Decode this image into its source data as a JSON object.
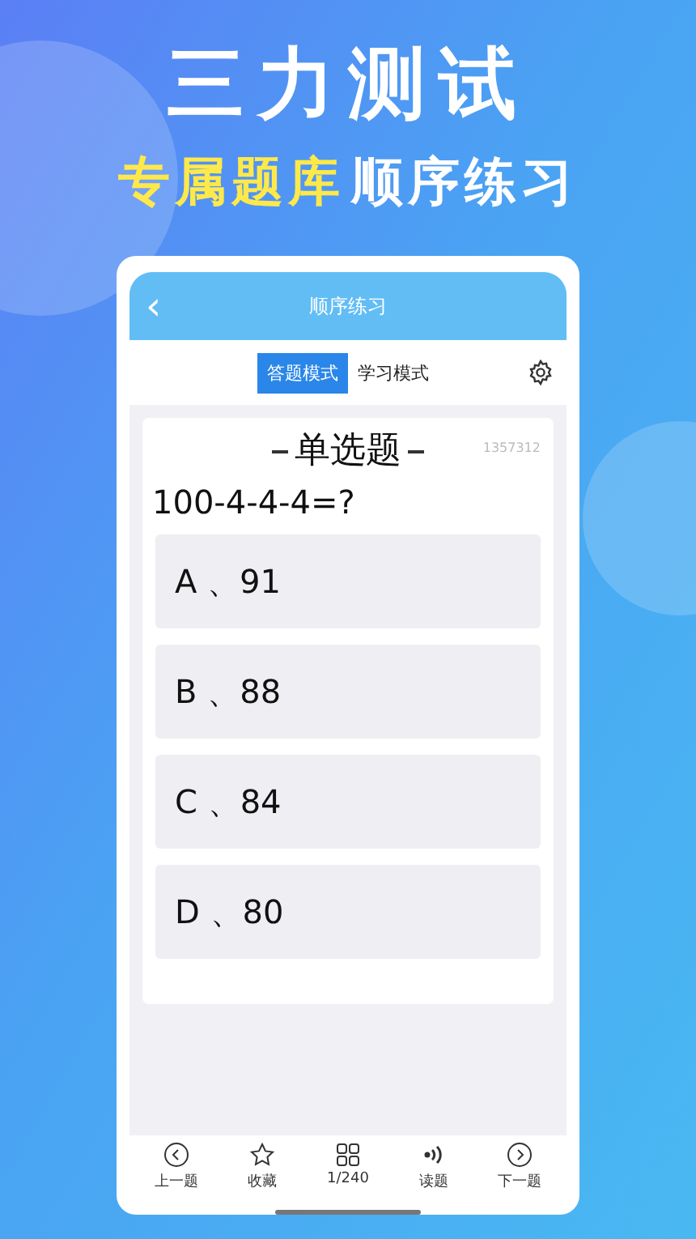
{
  "headline": "三力测试",
  "subtitle": {
    "highlight": "专属题库",
    "rest": "顺序练习"
  },
  "app": {
    "header": {
      "back": "‹",
      "title": "顺序练习"
    },
    "modes": [
      {
        "label": "答题模式",
        "selected": true
      },
      {
        "label": "学习模式",
        "selected": false
      }
    ],
    "question": {
      "type": "单选题",
      "id": "1357312",
      "text": "100-4-4-4=?",
      "options": [
        {
          "letter": "A",
          "sep": "、",
          "value": "91"
        },
        {
          "letter": "B",
          "sep": "、",
          "value": "88"
        },
        {
          "letter": "C",
          "sep": "、",
          "value": "84"
        },
        {
          "letter": "D",
          "sep": "、",
          "value": "80"
        }
      ]
    },
    "nav": [
      {
        "kind": "prev",
        "label": "上一题"
      },
      {
        "kind": "star",
        "label": "收藏"
      },
      {
        "kind": "grid",
        "label": "1/240"
      },
      {
        "kind": "audio",
        "label": "读题"
      },
      {
        "kind": "next",
        "label": "下一题"
      }
    ]
  }
}
